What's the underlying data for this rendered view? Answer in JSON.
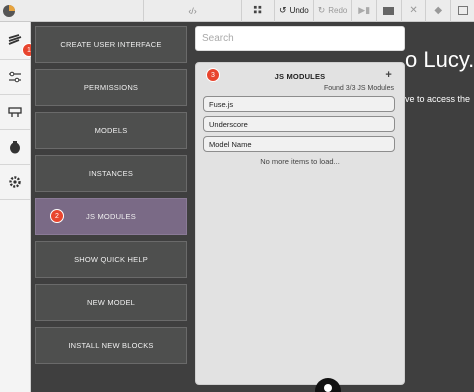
{
  "toolbar": {
    "undo_label": "Undo",
    "redo_label": "Redo"
  },
  "badges": {
    "one": "1",
    "two": "2",
    "three": "3"
  },
  "menu": {
    "items": [
      {
        "label": "CREATE USER INTERFACE"
      },
      {
        "label": "PERMISSIONS"
      },
      {
        "label": "MODELS"
      },
      {
        "label": "INSTANCES"
      },
      {
        "label": "JS MODULES"
      },
      {
        "label": "SHOW QUICK HELP"
      },
      {
        "label": "NEW MODEL"
      },
      {
        "label": "INSTALL NEW BLOCKS"
      }
    ]
  },
  "search": {
    "placeholder": "Search"
  },
  "panel": {
    "title": "JS MODULES",
    "plus": "+",
    "found": "Found 3/3 JS Modules",
    "fields": [
      "Fuse.js",
      "Underscore",
      "Model Name"
    ],
    "no_more": "No more items to load..."
  },
  "background": {
    "heading": "o Lucy.",
    "subtext": "ve to access the"
  },
  "colors": {
    "badge": "#e8452e",
    "selected_item": "#7a6a86",
    "menu_bg": "#4e4f4e",
    "app_bg": "#3f3f3f"
  }
}
